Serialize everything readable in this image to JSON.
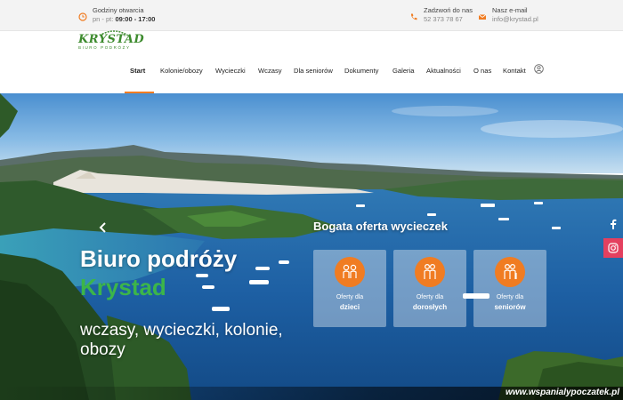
{
  "topbar": {
    "hours": {
      "title": "Godziny otwarcia",
      "prefix": "pn - pt:",
      "value": "09:00 - 17:00"
    },
    "phone": {
      "title": "Zadzwoń do nas",
      "value": "52 373 78 67"
    },
    "email": {
      "title": "Nasz e-mail",
      "value": "info@krystad.pl"
    }
  },
  "logo": {
    "name": "KRYSTAD",
    "tagline": "BIURO PODRÓŻY"
  },
  "nav": {
    "items": [
      "Start",
      "Kolonie/obozy",
      "Wycieczki",
      "Wczasy",
      "Dla seniorów",
      "Dokumenty",
      "Galeria",
      "Aktualności",
      "O nas",
      "Kontakt"
    ],
    "active": "Start"
  },
  "hero": {
    "title": "Biuro podróży",
    "title_accent": "Krystad",
    "subtitle": "wczasy, wycieczki, kolonie, obozy",
    "offers_title": "Bogata oferta wycieczek",
    "cards": [
      {
        "line1": "Oferty dla",
        "line2": "dzieci",
        "icon": "children-icon"
      },
      {
        "line1": "Oferty dla",
        "line2": "dorosłych",
        "icon": "adults-icon"
      },
      {
        "line1": "Oferty dla",
        "line2": "seniorów",
        "icon": "seniors-icon"
      }
    ]
  },
  "watermark": "www.wspanialypoczatek.pl",
  "colors": {
    "accent": "#f07c22",
    "brand_green": "#3cb54a",
    "instagram": "#e4405f"
  }
}
